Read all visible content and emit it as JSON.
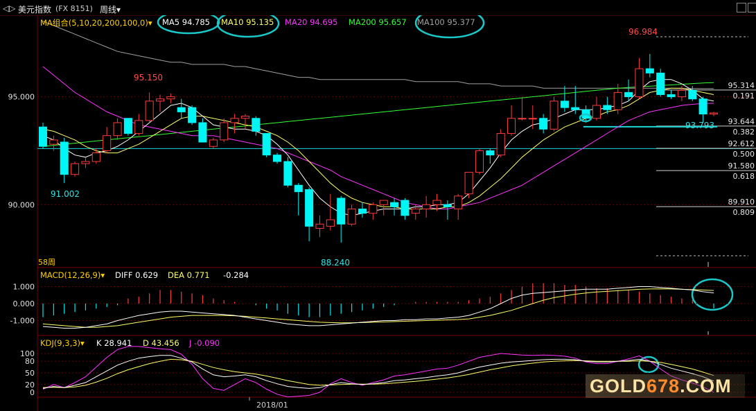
{
  "header": {
    "back_glyph": "◁▷",
    "title": "美元指数",
    "code": "(FX 8151)",
    "period": "周线",
    "period_arrow": "▾"
  },
  "colors": {
    "up": "#ff3b3b",
    "down": "#00f5f5",
    "ma5": "#ffffff",
    "ma10": "#ffff66",
    "ma20": "#ff33ff",
    "ma200": "#33ff33",
    "ma100": "#a0a0a0",
    "highlight_circle": "#19c8c8"
  },
  "main_legend": {
    "group": "MA组合(5,10,20,200,100,0)",
    "group_arrow": "▾",
    "ma5": "MA5 94.785",
    "ma10": "MA10 95.135",
    "ma20": "MA20 94.695",
    "ma200": "MA200 95.657",
    "ma100": "MA100 95.377"
  },
  "price_axis": {
    "labels": [
      "95.000",
      "90.000"
    ],
    "values": [
      95.0,
      90.0
    ]
  },
  "annotations": {
    "high_label": "96.984",
    "left_high": "95.150",
    "left_low": "91.002",
    "bottom_low": "88.240",
    "last_low": "93.793",
    "period_count": "58周"
  },
  "fib_levels": [
    {
      "price": "95.314",
      "ratio": "0.191",
      "value": 95.314
    },
    {
      "price": "93.644",
      "ratio": "0.382",
      "value": 93.644
    },
    {
      "price": "92.612",
      "ratio": "0.500",
      "value": 92.612
    },
    {
      "price": "91.580",
      "ratio": "0.618",
      "value": 91.58
    },
    {
      "price": "89.910",
      "ratio": "0.809",
      "value": 89.91
    }
  ],
  "macd_legend": {
    "name": "MACD(12,26,9)",
    "arrow": "▾",
    "diff": "DIFF 0.629",
    "dea": "DEA 0.771",
    "macd": "-0.284"
  },
  "macd_axis": {
    "labels": [
      "1.000",
      "0.000",
      "-1.000"
    ],
    "values": [
      1.0,
      0.0,
      -1.0
    ]
  },
  "kdj_legend": {
    "name": "KDJ(9,3,3)",
    "arrow": "▾",
    "k": "K 28.941",
    "d": "D 43.456",
    "j": "J -0.090"
  },
  "kdj_axis": {
    "labels": [
      "100",
      "80",
      "50",
      "20",
      "0"
    ],
    "values": [
      100,
      80,
      50,
      20,
      0
    ]
  },
  "date_label": "2018/01",
  "watermark": {
    "prefix": "GOLD",
    "digits": "678",
    "suffix": ".COM"
  },
  "chart_data": {
    "type": "candlestick",
    "ylim": [
      87.6,
      98.2
    ],
    "candles": [
      {
        "o": 93.6,
        "h": 93.8,
        "l": 92.6,
        "c": 92.7
      },
      {
        "o": 92.8,
        "h": 93.2,
        "l": 92.5,
        "c": 93.0
      },
      {
        "o": 92.9,
        "h": 93.1,
        "l": 91.0,
        "c": 91.4
      },
      {
        "o": 91.4,
        "h": 92.0,
        "l": 91.3,
        "c": 91.9
      },
      {
        "o": 91.9,
        "h": 92.2,
        "l": 91.7,
        "c": 92.0
      },
      {
        "o": 92.0,
        "h": 92.6,
        "l": 91.9,
        "c": 92.4
      },
      {
        "o": 92.5,
        "h": 93.6,
        "l": 92.4,
        "c": 93.2
      },
      {
        "o": 93.2,
        "h": 94.0,
        "l": 93.0,
        "c": 93.8
      },
      {
        "o": 94.0,
        "h": 94.0,
        "l": 93.2,
        "c": 93.3
      },
      {
        "o": 93.3,
        "h": 94.2,
        "l": 93.2,
        "c": 93.9
      },
      {
        "o": 93.9,
        "h": 95.2,
        "l": 93.8,
        "c": 94.8
      },
      {
        "o": 94.8,
        "h": 95.1,
        "l": 94.3,
        "c": 94.9
      },
      {
        "o": 94.9,
        "h": 95.15,
        "l": 94.7,
        "c": 95.0
      },
      {
        "o": 94.5,
        "h": 94.9,
        "l": 94.0,
        "c": 94.3
      },
      {
        "o": 94.5,
        "h": 94.6,
        "l": 93.7,
        "c": 93.8
      },
      {
        "o": 93.8,
        "h": 94.0,
        "l": 92.9,
        "c": 92.9
      },
      {
        "o": 92.7,
        "h": 93.1,
        "l": 92.6,
        "c": 93.0
      },
      {
        "o": 93.0,
        "h": 94.0,
        "l": 92.9,
        "c": 93.8
      },
      {
        "o": 93.8,
        "h": 94.2,
        "l": 93.3,
        "c": 94.0
      },
      {
        "o": 94.0,
        "h": 94.2,
        "l": 93.5,
        "c": 94.1
      },
      {
        "o": 94.0,
        "h": 94.1,
        "l": 93.2,
        "c": 93.4
      },
      {
        "o": 93.3,
        "h": 93.3,
        "l": 92.2,
        "c": 92.3
      },
      {
        "o": 92.3,
        "h": 92.4,
        "l": 91.9,
        "c": 92.0
      },
      {
        "o": 92.0,
        "h": 92.2,
        "l": 90.8,
        "c": 90.9
      },
      {
        "o": 90.9,
        "h": 91.0,
        "l": 89.5,
        "c": 90.6
      },
      {
        "o": 90.7,
        "h": 90.8,
        "l": 88.3,
        "c": 89.0
      },
      {
        "o": 88.9,
        "h": 89.5,
        "l": 88.5,
        "c": 89.1
      },
      {
        "o": 89.0,
        "h": 90.5,
        "l": 88.8,
        "c": 89.3
      },
      {
        "o": 90.3,
        "h": 90.4,
        "l": 88.24,
        "c": 89.1
      },
      {
        "o": 89.1,
        "h": 90.0,
        "l": 89.0,
        "c": 89.8
      },
      {
        "o": 89.8,
        "h": 90.1,
        "l": 89.4,
        "c": 89.6
      },
      {
        "o": 89.6,
        "h": 90.1,
        "l": 89.3,
        "c": 90.0
      },
      {
        "o": 90.0,
        "h": 90.2,
        "l": 89.5,
        "c": 90.2
      },
      {
        "o": 90.1,
        "h": 90.3,
        "l": 89.5,
        "c": 89.9
      },
      {
        "o": 90.2,
        "h": 90.3,
        "l": 89.3,
        "c": 89.5
      },
      {
        "o": 89.6,
        "h": 90.0,
        "l": 89.3,
        "c": 89.8
      },
      {
        "o": 89.8,
        "h": 90.4,
        "l": 89.4,
        "c": 90.0
      },
      {
        "o": 90.0,
        "h": 90.5,
        "l": 89.7,
        "c": 90.2
      },
      {
        "o": 90.0,
        "h": 90.2,
        "l": 89.3,
        "c": 89.9
      },
      {
        "o": 89.8,
        "h": 90.5,
        "l": 89.3,
        "c": 90.4
      },
      {
        "o": 90.5,
        "h": 91.5,
        "l": 90.3,
        "c": 91.5
      },
      {
        "o": 91.5,
        "h": 92.6,
        "l": 91.4,
        "c": 92.5
      },
      {
        "o": 92.5,
        "h": 92.6,
        "l": 91.9,
        "c": 92.3
      },
      {
        "o": 92.3,
        "h": 93.5,
        "l": 92.2,
        "c": 93.3
      },
      {
        "o": 93.3,
        "h": 94.6,
        "l": 93.2,
        "c": 94.0
      },
      {
        "o": 94.0,
        "h": 95.0,
        "l": 93.9,
        "c": 94.0
      },
      {
        "o": 94.0,
        "h": 94.6,
        "l": 93.5,
        "c": 94.0
      },
      {
        "o": 94.0,
        "h": 94.2,
        "l": 93.3,
        "c": 93.5
      },
      {
        "o": 93.5,
        "h": 95.0,
        "l": 93.4,
        "c": 94.8
      },
      {
        "o": 94.8,
        "h": 95.5,
        "l": 94.3,
        "c": 94.5
      },
      {
        "o": 94.5,
        "h": 95.5,
        "l": 94.2,
        "c": 94.4
      },
      {
        "o": 94.4,
        "h": 94.6,
        "l": 93.8,
        "c": 94.0
      },
      {
        "o": 94.0,
        "h": 95.0,
        "l": 93.9,
        "c": 94.6
      },
      {
        "o": 94.6,
        "h": 95.0,
        "l": 94.2,
        "c": 94.4
      },
      {
        "o": 94.4,
        "h": 95.6,
        "l": 94.2,
        "c": 95.2
      },
      {
        "o": 95.2,
        "h": 95.8,
        "l": 94.8,
        "c": 95.0
      },
      {
        "o": 95.0,
        "h": 96.8,
        "l": 94.9,
        "c": 96.3
      },
      {
        "o": 96.3,
        "h": 96.984,
        "l": 95.9,
        "c": 96.1
      },
      {
        "o": 96.1,
        "h": 96.3,
        "l": 95.0,
        "c": 95.1
      },
      {
        "o": 95.1,
        "h": 95.3,
        "l": 94.9,
        "c": 95.0
      },
      {
        "o": 95.0,
        "h": 95.5,
        "l": 94.8,
        "c": 95.3
      },
      {
        "o": 95.3,
        "h": 95.5,
        "l": 94.8,
        "c": 94.9
      },
      {
        "o": 94.9,
        "h": 95.0,
        "l": 93.8,
        "c": 94.2
      },
      {
        "o": 94.2,
        "h": 94.3,
        "l": 94.1,
        "c": 94.25
      }
    ],
    "ma5": [
      93.2,
      93.0,
      92.6,
      92.3,
      92.2,
      92.4,
      92.5,
      92.7,
      93.0,
      93.4,
      93.8,
      94.2,
      94.6,
      94.7,
      94.5,
      94.1,
      93.7,
      93.6,
      93.5,
      93.5,
      93.4,
      93.2,
      92.8,
      92.3,
      91.6,
      90.9,
      90.3,
      89.9,
      89.6,
      89.5,
      89.6,
      89.7,
      89.8,
      89.8,
      89.8,
      89.9,
      89.9,
      90.0,
      90.0,
      90.1,
      90.5,
      91.1,
      91.7,
      92.4,
      93.0,
      93.4,
      93.7,
      93.8,
      94.0,
      94.2,
      94.4,
      94.4,
      94.4,
      94.5,
      94.6,
      94.8,
      95.3,
      95.7,
      95.8,
      95.8,
      95.6,
      95.3,
      94.9,
      94.8
    ],
    "ma10": [
      93.5,
      93.4,
      93.2,
      93.0,
      92.7,
      92.5,
      92.4,
      92.4,
      92.6,
      92.8,
      93.1,
      93.4,
      93.7,
      94.0,
      94.1,
      94.1,
      94.0,
      93.9,
      93.8,
      93.7,
      93.6,
      93.4,
      93.2,
      92.9,
      92.5,
      92.0,
      91.5,
      91.0,
      90.6,
      90.3,
      90.1,
      90.0,
      89.9,
      89.9,
      89.8,
      89.8,
      89.8,
      89.8,
      89.9,
      89.9,
      90.1,
      90.4,
      90.8,
      91.2,
      91.7,
      92.2,
      92.6,
      93.0,
      93.3,
      93.6,
      93.8,
      94.0,
      94.1,
      94.3,
      94.4,
      94.6,
      94.9,
      95.2,
      95.3,
      95.4,
      95.4,
      95.3,
      95.2,
      95.1
    ],
    "ma20": [
      96.4,
      96.0,
      95.6,
      95.2,
      94.9,
      94.6,
      94.3,
      94.1,
      93.9,
      93.7,
      93.6,
      93.5,
      93.4,
      93.3,
      93.2,
      93.2,
      93.2,
      93.1,
      93.0,
      92.9,
      92.8,
      92.7,
      92.6,
      92.4,
      92.2,
      92.0,
      91.8,
      91.6,
      91.3,
      91.1,
      90.9,
      90.7,
      90.5,
      90.3,
      90.1,
      90.0,
      89.9,
      89.8,
      89.8,
      89.9,
      90.0,
      90.1,
      90.3,
      90.5,
      90.7,
      90.9,
      91.2,
      91.5,
      91.8,
      92.1,
      92.4,
      92.7,
      93.0,
      93.3,
      93.6,
      93.9,
      94.1,
      94.3,
      94.4,
      94.5,
      94.6,
      94.65,
      94.69,
      94.7
    ],
    "ma100": [
      98.5,
      98.3,
      98.1,
      97.9,
      97.7,
      97.5,
      97.3,
      97.1,
      97.0,
      96.9,
      96.8,
      96.7,
      96.6,
      96.6,
      96.5,
      96.5,
      96.5,
      96.5,
      96.4,
      96.4,
      96.3,
      96.2,
      96.1,
      96.0,
      95.9,
      95.9,
      95.8,
      95.8,
      95.8,
      95.8,
      95.8,
      95.8,
      95.8,
      95.8,
      95.8,
      95.7,
      95.7,
      95.7,
      95.7,
      95.7,
      95.6,
      95.6,
      95.6,
      95.5,
      95.5,
      95.5,
      95.5,
      95.4,
      95.4,
      95.4,
      95.4,
      95.4,
      95.4,
      95.4,
      95.4,
      95.4,
      95.4,
      95.4,
      95.4,
      95.4,
      95.38,
      95.38,
      95.377,
      95.377
    ],
    "ma200": [
      92.7,
      92.75,
      92.8,
      92.85,
      92.9,
      92.95,
      93.0,
      93.05,
      93.1,
      93.15,
      93.2,
      93.25,
      93.3,
      93.35,
      93.4,
      93.45,
      93.5,
      93.55,
      93.6,
      93.65,
      93.7,
      93.75,
      93.8,
      93.85,
      93.9,
      93.95,
      94.0,
      94.05,
      94.1,
      94.15,
      94.2,
      94.25,
      94.3,
      94.35,
      94.4,
      94.45,
      94.5,
      94.55,
      94.6,
      94.65,
      94.7,
      94.75,
      94.8,
      94.85,
      94.9,
      94.95,
      95.0,
      95.05,
      95.1,
      95.15,
      95.2,
      95.25,
      95.3,
      95.35,
      95.4,
      95.43,
      95.46,
      95.49,
      95.52,
      95.55,
      95.58,
      95.61,
      95.64,
      95.657
    ],
    "macd_hist": [
      -0.8,
      -0.7,
      -0.6,
      -0.5,
      -0.4,
      -0.3,
      -0.2,
      -0.1,
      0.3,
      0.4,
      0.6,
      0.8,
      0.8,
      0.7,
      0.6,
      0.5,
      0.3,
      0.2,
      0.1,
      0.0,
      -0.1,
      -0.3,
      -0.4,
      -0.6,
      -0.7,
      -0.8,
      -0.8,
      -0.7,
      -0.6,
      -0.5,
      -0.4,
      -0.3,
      -0.2,
      -0.1,
      0.0,
      0.1,
      0.1,
      0.1,
      0.1,
      0.1,
      0.2,
      0.3,
      0.4,
      0.6,
      0.8,
      1.0,
      1.2,
      1.2,
      1.2,
      1.1,
      1.1,
      1.0,
      0.9,
      0.9,
      0.8,
      0.8,
      0.7,
      0.6,
      0.5,
      0.4,
      0.3,
      0.2,
      0.0,
      -0.284
    ],
    "macd_diff": [
      -1.35,
      -1.4,
      -1.45,
      -1.45,
      -1.4,
      -1.3,
      -1.2,
      -1.0,
      -0.85,
      -0.7,
      -0.6,
      -0.5,
      -0.45,
      -0.45,
      -0.5,
      -0.55,
      -0.6,
      -0.65,
      -0.7,
      -0.8,
      -0.9,
      -1.0,
      -1.1,
      -1.2,
      -1.25,
      -1.3,
      -1.3,
      -1.25,
      -1.2,
      -1.15,
      -1.1,
      -1.05,
      -1.0,
      -1.0,
      -0.95,
      -0.95,
      -0.9,
      -0.9,
      -0.85,
      -0.8,
      -0.7,
      -0.5,
      -0.3,
      0.0,
      0.3,
      0.5,
      0.6,
      0.65,
      0.7,
      0.75,
      0.8,
      0.85,
      0.85,
      0.85,
      0.9,
      0.95,
      1.0,
      1.0,
      0.95,
      0.9,
      0.85,
      0.8,
      0.7,
      0.629
    ],
    "macd_dea": [
      -1.2,
      -1.25,
      -1.3,
      -1.35,
      -1.4,
      -1.4,
      -1.35,
      -1.3,
      -1.2,
      -1.1,
      -1.0,
      -0.9,
      -0.8,
      -0.75,
      -0.7,
      -0.7,
      -0.7,
      -0.7,
      -0.72,
      -0.75,
      -0.8,
      -0.85,
      -0.9,
      -0.95,
      -1.0,
      -1.05,
      -1.1,
      -1.12,
      -1.13,
      -1.13,
      -1.12,
      -1.1,
      -1.08,
      -1.06,
      -1.04,
      -1.02,
      -1.0,
      -0.98,
      -0.96,
      -0.94,
      -0.9,
      -0.8,
      -0.7,
      -0.55,
      -0.4,
      -0.2,
      0.0,
      0.2,
      0.35,
      0.45,
      0.55,
      0.62,
      0.68,
      0.72,
      0.76,
      0.8,
      0.84,
      0.86,
      0.87,
      0.86,
      0.84,
      0.82,
      0.8,
      0.771
    ],
    "kdj_k": [
      10,
      15,
      12,
      18,
      25,
      40,
      55,
      70,
      80,
      88,
      92,
      95,
      95,
      88,
      78,
      60,
      45,
      40,
      42,
      45,
      40,
      30,
      22,
      15,
      12,
      10,
      12,
      20,
      25,
      22,
      20,
      22,
      25,
      30,
      32,
      35,
      38,
      42,
      45,
      50,
      58,
      65,
      70,
      75,
      78,
      80,
      82,
      84,
      85,
      85,
      84,
      80,
      78,
      78,
      80,
      82,
      85,
      80,
      72,
      62,
      55,
      48,
      40,
      28.941
    ],
    "kdj_d": [
      12,
      13,
      12,
      14,
      18,
      26,
      36,
      48,
      58,
      66,
      74,
      80,
      85,
      84,
      80,
      72,
      64,
      58,
      53,
      50,
      47,
      42,
      36,
      30,
      25,
      20,
      18,
      19,
      20,
      21,
      21,
      21,
      22,
      24,
      26,
      28,
      31,
      34,
      37,
      41,
      46,
      52,
      58,
      63,
      68,
      72,
      75,
      78,
      80,
      81,
      82,
      81,
      80,
      80,
      80,
      80,
      81,
      80,
      77,
      72,
      66,
      60,
      52,
      43.456
    ],
    "kdj_j": [
      8,
      20,
      12,
      25,
      40,
      65,
      90,
      110,
      118,
      118,
      115,
      112,
      110,
      98,
      72,
      35,
      10,
      5,
      20,
      35,
      25,
      8,
      -5,
      -12,
      -10,
      -8,
      0,
      22,
      35,
      25,
      18,
      25,
      32,
      42,
      45,
      50,
      55,
      60,
      62,
      70,
      80,
      90,
      95,
      100,
      98,
      96,
      95,
      96,
      95,
      93,
      88,
      78,
      74,
      74,
      80,
      86,
      94,
      80,
      60,
      42,
      32,
      24,
      14,
      -0.09
    ]
  }
}
